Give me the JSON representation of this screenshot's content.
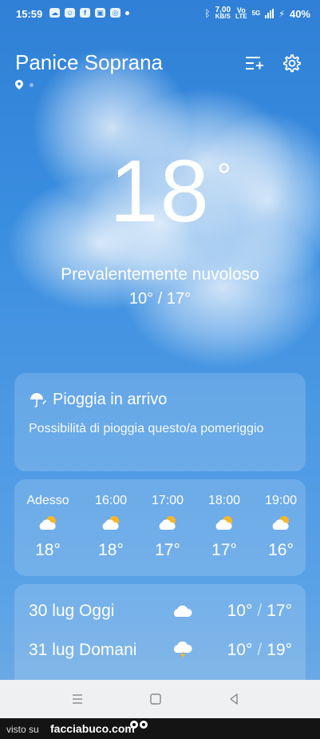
{
  "status_bar": {
    "time": "15:59",
    "net_speed_value": "7,00",
    "net_speed_unit": "KB/S",
    "vo_lte_top": "Vo",
    "vo_lte_bottom": "LTE",
    "network": "5G",
    "battery": "40%"
  },
  "header": {
    "city": "Panice Soprana"
  },
  "current": {
    "temperature": "18",
    "degree_symbol": "°",
    "condition": "Prevalentemente nuvoloso",
    "range": "10° / 17°"
  },
  "rain_alert": {
    "title": "Pioggia in arrivo",
    "description": "Possibilità di pioggia questo/a pomeriggio"
  },
  "hourly": [
    {
      "time": "Adesso",
      "temp": "18°",
      "icon": "partly-cloudy-icon"
    },
    {
      "time": "16:00",
      "temp": "18°",
      "icon": "partly-cloudy-icon"
    },
    {
      "time": "17:00",
      "temp": "17°",
      "icon": "partly-cloudy-icon"
    },
    {
      "time": "18:00",
      "temp": "17°",
      "icon": "partly-cloudy-icon"
    },
    {
      "time": "19:00",
      "temp": "16°",
      "icon": "partly-cloudy-icon"
    }
  ],
  "daily": [
    {
      "label": "30 lug Oggi",
      "icon": "cloud-icon",
      "low": "10°",
      "high": "17°"
    },
    {
      "label": "31 lug Domani",
      "icon": "thunderstorm-icon",
      "low": "10°",
      "high": "19°"
    }
  ],
  "footer": {
    "visto_su": "visto su",
    "site": "facciabuco.com"
  },
  "colors": {
    "sky_top": "#2f80d6",
    "sky_bottom": "#6aa9e4",
    "sun": "#f5b62a",
    "navbar": "#eef0f2"
  }
}
